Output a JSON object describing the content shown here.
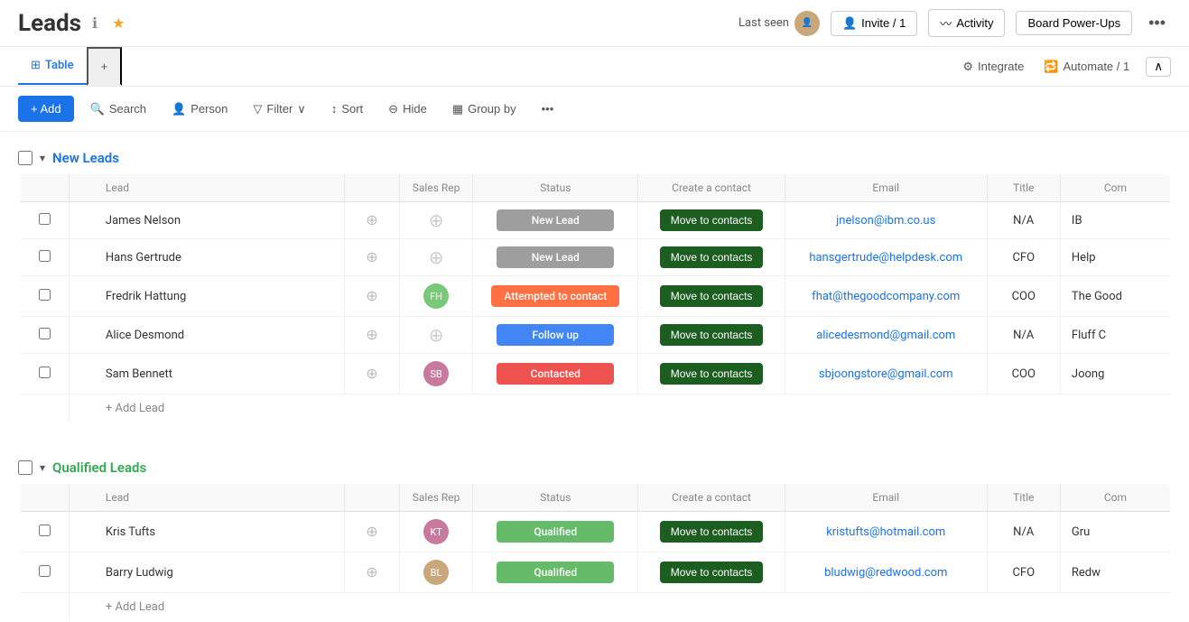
{
  "header": {
    "title": "Leads",
    "last_seen_label": "Last seen",
    "invite_label": "Invite / 1",
    "activity_label": "Activity",
    "board_powerups_label": "Board Power-Ups"
  },
  "tabs": {
    "table_label": "Table",
    "add_tab_label": "+",
    "integrate_label": "Integrate",
    "automate_label": "Automate / 1"
  },
  "toolbar": {
    "add_label": "+ Add",
    "search_label": "Search",
    "person_label": "Person",
    "filter_label": "Filter",
    "sort_label": "Sort",
    "hide_label": "Hide",
    "group_by_label": "Group by"
  },
  "groups": [
    {
      "id": "new-leads",
      "title": "New Leads",
      "color": "blue",
      "columns": {
        "lead": "Lead",
        "sales_rep": "Sales Rep",
        "status": "Status",
        "create_contact": "Create a contact",
        "email": "Email",
        "title": "Title",
        "company": "Com"
      },
      "rows": [
        {
          "name": "James Nelson",
          "sales_rep_avatar": null,
          "status": "New Lead",
          "status_class": "status-new-lead",
          "email": "jnelson@ibm.co.us",
          "title": "N/A",
          "company": "IB"
        },
        {
          "name": "Hans Gertrude",
          "sales_rep_avatar": null,
          "status": "New Lead",
          "status_class": "status-new-lead",
          "email": "hansgertrude@helpdesk.com",
          "title": "CFO",
          "company": "Help"
        },
        {
          "name": "Fredrik Hattung",
          "sales_rep_avatar": "FH",
          "status": "Attempted to contact",
          "status_class": "status-attempted",
          "email": "fhat@thegoodcompany.com",
          "title": "COO",
          "company": "The Good"
        },
        {
          "name": "Alice Desmond",
          "sales_rep_avatar": null,
          "status": "Follow up",
          "status_class": "status-follow-up",
          "email": "alicedesmond@gmail.com",
          "title": "N/A",
          "company": "Fluff C"
        },
        {
          "name": "Sam Bennett",
          "sales_rep_avatar": "SB",
          "status": "Contacted",
          "status_class": "status-contacted",
          "email": "sbjoongstore@gmail.com",
          "title": "COO",
          "company": "Joong"
        }
      ],
      "add_label": "+ Add Lead",
      "move_label": "Move to contacts"
    }
  ],
  "groups2": [
    {
      "id": "qualified-leads",
      "title": "Qualified Leads",
      "color": "green",
      "columns": {
        "lead": "Lead",
        "sales_rep": "Sales Rep",
        "status": "Status",
        "create_contact": "Create a contact",
        "email": "Email",
        "title": "Title",
        "company": "Com"
      },
      "rows": [
        {
          "name": "Kris Tufts",
          "sales_rep_avatar": "KT",
          "status": "Qualified",
          "status_class": "status-qualified",
          "email": "kristufts@hotmail.com",
          "title": "N/A",
          "company": "Gru"
        },
        {
          "name": "Barry Ludwig",
          "sales_rep_avatar": "BL",
          "status": "Qualified",
          "status_class": "status-qualified",
          "email": "bludwig@redwood.com",
          "title": "CFO",
          "company": "Redw"
        }
      ],
      "add_label": "+ Add Lead",
      "move_label": "Move to contacts"
    }
  ]
}
